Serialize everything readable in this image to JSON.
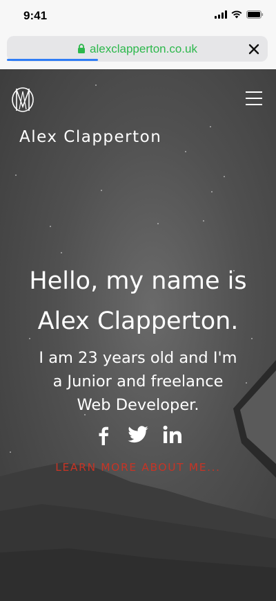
{
  "status_bar": {
    "time": "9:41"
  },
  "browser": {
    "url": "alexclapperton.co.uk",
    "page_load_progress_percent": 35
  },
  "icons": {
    "lock": "lock-icon",
    "close": "close-icon",
    "logo": "am-monogram-logo",
    "menu": "hamburger-menu-icon",
    "social": [
      "facebook-icon",
      "twitter-icon",
      "linkedin-icon"
    ]
  },
  "colors": {
    "url_green": "#2db84c",
    "progress_blue": "#2f7df6",
    "cta_red": "#c73425"
  },
  "hero": {
    "site_name": "Alex Clapperton",
    "headline_line1": "Hello, my name is",
    "headline_line2": "Alex Clapperton.",
    "subline_line1": "I am 23 years old and I'm",
    "subline_line2": "a Junior and freelance",
    "subline_line3": "Web Developer.",
    "cta_label": "LEARN MORE ABOUT ME..."
  }
}
